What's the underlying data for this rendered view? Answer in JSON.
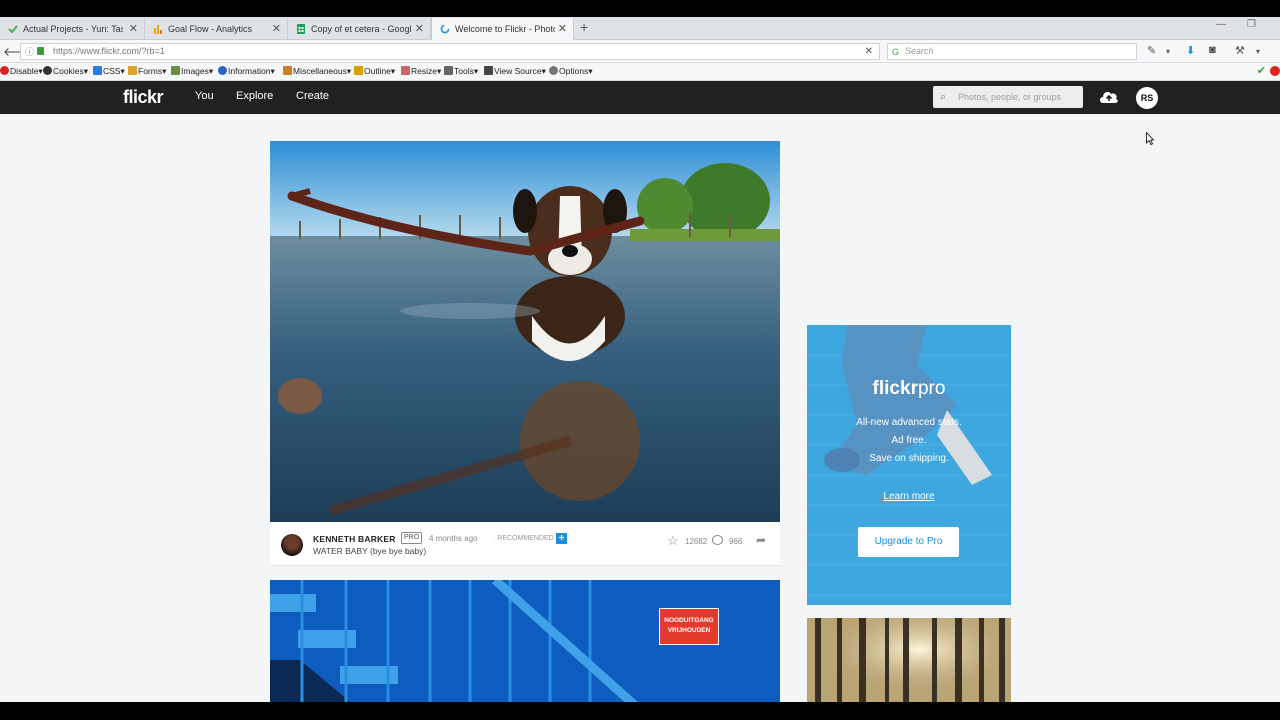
{
  "browser": {
    "tabs": [
      {
        "title": "Actual Projects - Yuri: Tasks",
        "icon_color": "#4caf50"
      },
      {
        "title": "Goal Flow - Analytics",
        "icon_color": "#f4a300"
      },
      {
        "title": "Copy of et cetera - Google...",
        "icon_color": "#1e9e58"
      },
      {
        "title": "Welcome to Flickr - Photo...",
        "icon_color": "#1c8fe0"
      }
    ],
    "new_tab": "+",
    "url": "https://www.flickr.com/?rb=1",
    "search_placeholder": "Search",
    "dev_toolbar": [
      {
        "label": "Disable▾",
        "icon": "disable-icon",
        "color": "#d22"
      },
      {
        "label": "Cookies▾",
        "icon": "cookie-icon",
        "color": "#333"
      },
      {
        "label": "CSS▾",
        "icon": "css-icon",
        "color": "#2a7de1"
      },
      {
        "label": "Forms▾",
        "icon": "forms-icon",
        "color": "#e0a030"
      },
      {
        "label": "Images▾",
        "icon": "images-icon",
        "color": "#6a8e3f"
      },
      {
        "label": "Information▾",
        "icon": "info-icon",
        "color": "#2a62c9"
      },
      {
        "label": "Miscellaneous▾",
        "icon": "misc-icon",
        "color": "#c9802a"
      },
      {
        "label": "Outline▾",
        "icon": "outline-icon",
        "color": "#d8a000"
      },
      {
        "label": "Resize▾",
        "icon": "resize-icon",
        "color": "#c66"
      },
      {
        "label": "Tools▾",
        "icon": "tools-icon",
        "color": "#666"
      },
      {
        "label": "View Source▾",
        "icon": "view-source-icon",
        "color": "#444"
      },
      {
        "label": "Options▾",
        "icon": "options-icon",
        "color": "#777"
      }
    ]
  },
  "header": {
    "logo": "flickr",
    "nav": [
      "You",
      "Explore",
      "Create"
    ],
    "search_placeholder": "Photos, people, or groups",
    "avatar_initials": "RS"
  },
  "feed": {
    "post1": {
      "author": "KENNETH BARKER",
      "pro": "PRO",
      "age": "4 months ago",
      "recommended": "· RECOMMENDED",
      "plus": "+",
      "title": "WATER BABY (bye bye baby)",
      "favs": "12682",
      "comments": "966"
    },
    "post2": {
      "sign_text": "NOODUITGANG VRIJHOUDEN"
    }
  },
  "ad": {
    "logo_main": "flickr",
    "logo_sub": "pro",
    "lines": [
      "All-new advanced stats.",
      "Ad free.",
      "Save on shipping."
    ],
    "learn_more": "Learn more",
    "cta": "Upgrade to Pro"
  },
  "colors": {
    "flickr_header": "#212124",
    "page_bg": "#f3f5f6",
    "accent_blue": "#1c8fe0",
    "ad_blue": "#3ea7df"
  }
}
